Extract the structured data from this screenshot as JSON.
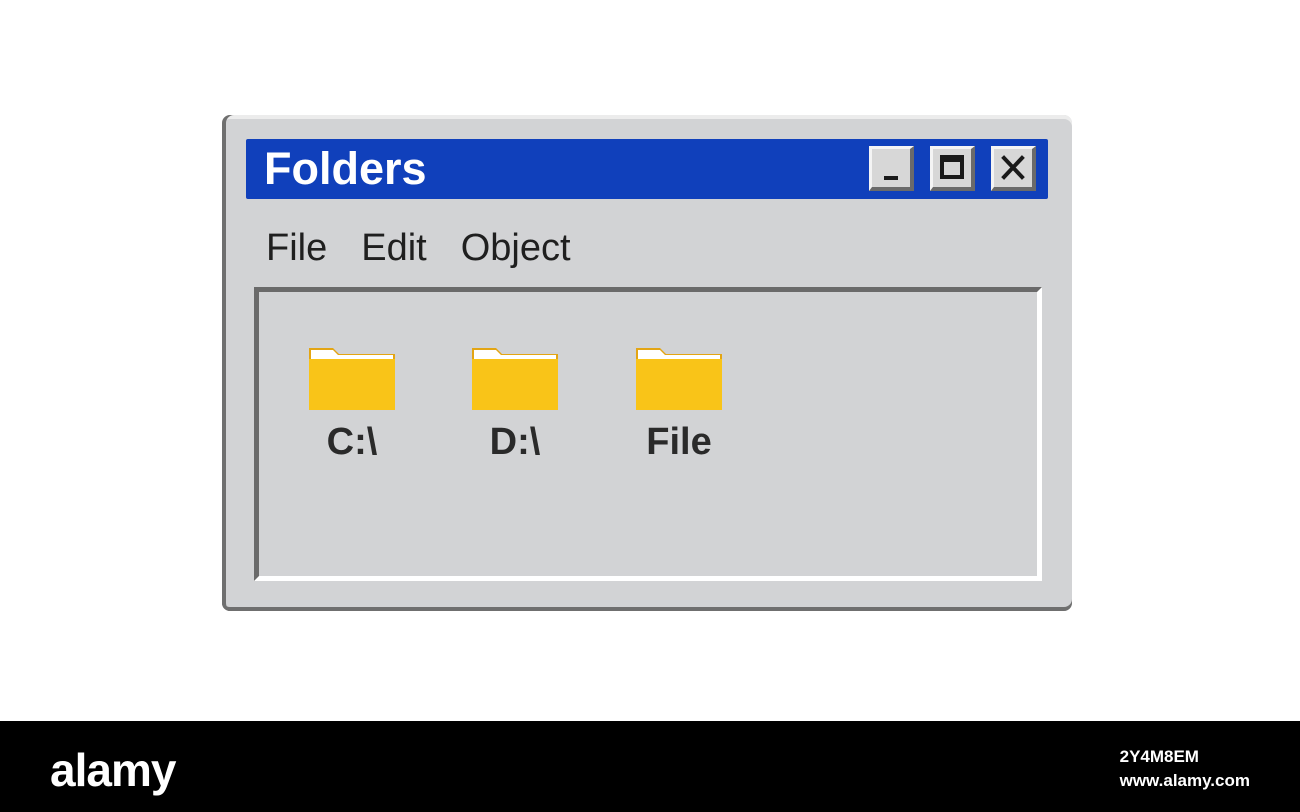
{
  "window": {
    "title": "Folders",
    "controls": {
      "minimize_icon": "minimize-icon",
      "maximize_icon": "maximize-icon",
      "close_icon": "close-icon"
    }
  },
  "menu": {
    "items": [
      {
        "label": "File"
      },
      {
        "label": "Edit"
      },
      {
        "label": "Object"
      }
    ]
  },
  "folders": [
    {
      "label": "C:\\",
      "icon": "folder-icon"
    },
    {
      "label": "D:\\",
      "icon": "folder-icon"
    },
    {
      "label": "File",
      "icon": "folder-icon"
    }
  ],
  "footer": {
    "brand": "alamy",
    "image_id": "2Y4M8EM",
    "url": "www.alamy.com"
  },
  "colors": {
    "titlebar": "#1040bb",
    "window_bg": "#d2d3d5",
    "folder": "#f9c418",
    "folder_shadow": "#e3a514"
  }
}
